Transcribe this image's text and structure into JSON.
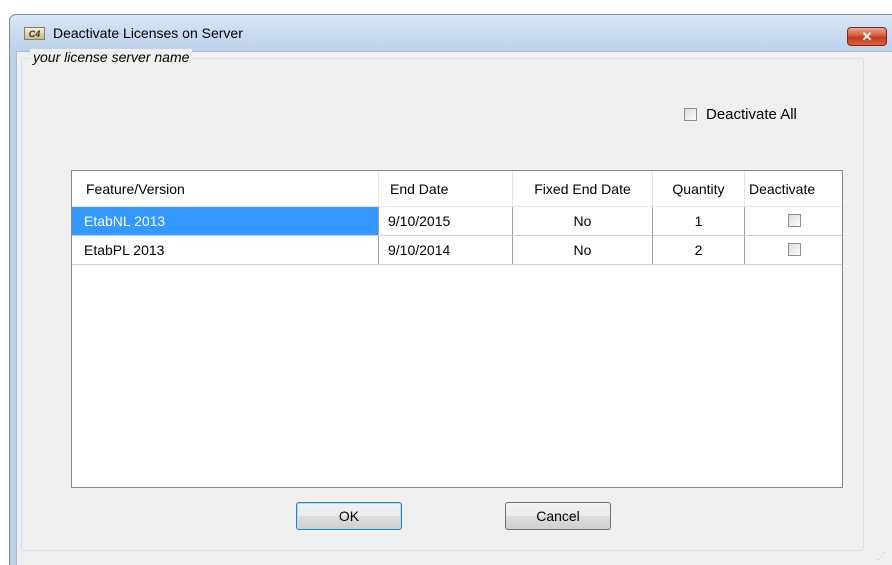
{
  "window": {
    "title": "Deactivate Licenses on Server",
    "icon": "etab-app-icon",
    "close_icon": "✕"
  },
  "group": {
    "label": "your license server name"
  },
  "deactivate_all": {
    "label": "Deactivate All",
    "checked": false
  },
  "table": {
    "columns": [
      "Feature/Version",
      "End Date",
      "Fixed End Date",
      "Quantity",
      "Deactivate"
    ],
    "rows": [
      {
        "feature": "EtabNL 2013",
        "end_date": "9/10/2015",
        "fixed_end_date": "No",
        "quantity": "1",
        "deactivate": false,
        "selected": true
      },
      {
        "feature": "EtabPL 2013",
        "end_date": "9/10/2014",
        "fixed_end_date": "No",
        "quantity": "2",
        "deactivate": false,
        "selected": false
      }
    ]
  },
  "buttons": {
    "ok": "OK",
    "cancel": "Cancel"
  },
  "colors": {
    "selection": "#3399ff",
    "close_button": "#c23b1f"
  }
}
